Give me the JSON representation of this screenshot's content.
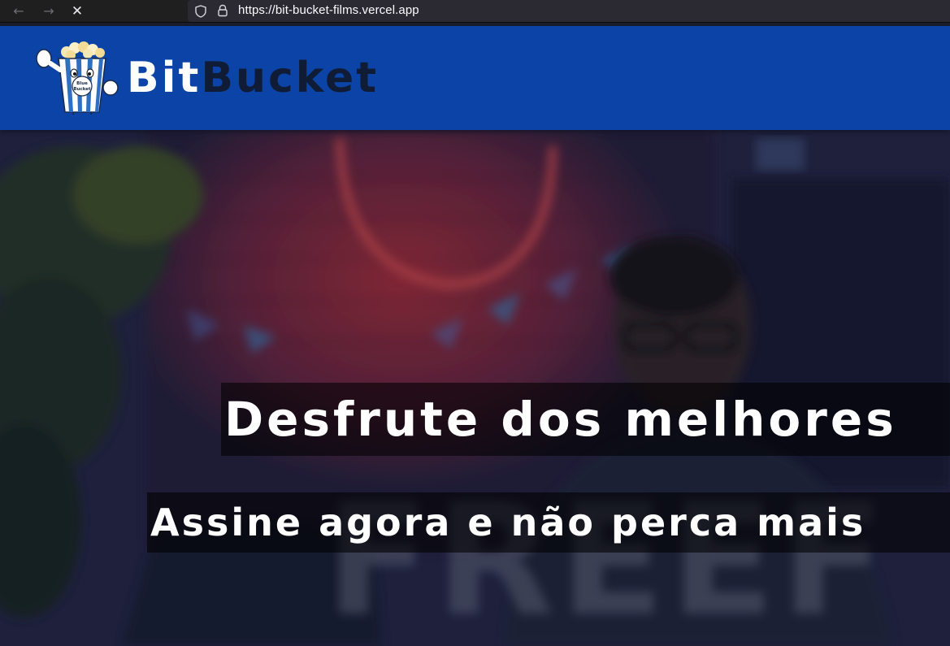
{
  "browser": {
    "url": "https://bit-bucket-films.vercel.app",
    "back_icon": "arrow-left-icon",
    "forward_icon": "arrow-right-icon",
    "stop_icon": "close-icon",
    "shield_icon": "shield-icon",
    "lock_icon": "lock-icon"
  },
  "header": {
    "brand_part1": "Bit",
    "brand_part2": "Bucket",
    "mascot_label_line1": "Blue",
    "mascot_label_line2": "Bucket",
    "colors": {
      "header_bg": "#0b44a6",
      "brand_part1": "#ffffff",
      "brand_part2": "#101c36"
    }
  },
  "hero": {
    "headline": "Desfrute dos melhores",
    "subline": "Assine agora e não perca mais",
    "background_text": "FREEF"
  }
}
